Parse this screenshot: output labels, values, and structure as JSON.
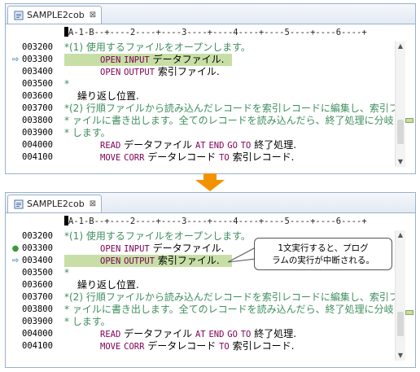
{
  "editor": {
    "tab_label": "SAMPLE2cob",
    "close_glyph": "⊠",
    "ruler": "A-1-B--+----2----+----3----+----4----+----5----+----6----+"
  },
  "top_lines": [
    {
      "num": "003200",
      "gutter": "",
      "text": "*(1) 使用するファイルをオープンします。"
    },
    {
      "num": "003300",
      "gutter": "⇨",
      "text": "OPEN INPUT データファイル."
    },
    {
      "num": "003400",
      "gutter": "",
      "text": "OPEN OUTPUT 索引ファイル."
    },
    {
      "num": "003500",
      "gutter": "",
      "text": "*"
    },
    {
      "num": "003600",
      "gutter": "",
      "text": "繰り返し位置."
    },
    {
      "num": "003700",
      "gutter": "",
      "text": "*(2) 行順ファイルから読み込んだレコードを索引レコードに編集し、索引フ"
    },
    {
      "num": "003800",
      "gutter": "",
      "text": "*     ァイルに書き出します。全てのレコードを読み込んだら、終了処理に分岐"
    },
    {
      "num": "003900",
      "gutter": "",
      "text": "*     します。"
    },
    {
      "num": "004000",
      "gutter": "",
      "text": "READ データファイル AT END GO TO 終了処理."
    },
    {
      "num": "004100",
      "gutter": "",
      "text": "MOVE CORR データレコード TO 索引レコード."
    }
  ],
  "bottom_lines": [
    {
      "num": "003200",
      "gutter": "",
      "text": "*(1) 使用するファイルをオープンします。"
    },
    {
      "num": "003300",
      "gutter": "●",
      "text": "OPEN INPUT データファイル."
    },
    {
      "num": "003400",
      "gutter": "⇨",
      "text": "OPEN OUTPUT 索引ファイル."
    },
    {
      "num": "003500",
      "gutter": "",
      "text": "*"
    },
    {
      "num": "003600",
      "gutter": "",
      "text": "繰り返し位置."
    },
    {
      "num": "003700",
      "gutter": "",
      "text": "*(2) 行順ファイルから読み込んだレコードを索引レコードに編集し、索引フ"
    },
    {
      "num": "003800",
      "gutter": "",
      "text": "*     ァイルに書き出します。全てのレコードを読み込んだら、終了処理に分岐"
    },
    {
      "num": "003900",
      "gutter": "",
      "text": "*     します。"
    },
    {
      "num": "004000",
      "gutter": "",
      "text": "READ データファイル AT END GO TO 終了処理."
    },
    {
      "num": "004100",
      "gutter": "",
      "text": "MOVE CORR データレコード TO 索引レコード."
    }
  ],
  "callout": {
    "line1": "1文実行すると、プログ",
    "line2": "ラムの実行が中断される。"
  },
  "colors": {
    "comment": "#3f8f5f",
    "keyword": "#7f0055",
    "highlight": "#c7dfa6",
    "arrow": "#f39200"
  },
  "icons": {
    "current_line": "arrow-right-icon",
    "breakpoint": "breakpoint-dot-icon",
    "step_arrow": "down-arrow-icon"
  }
}
